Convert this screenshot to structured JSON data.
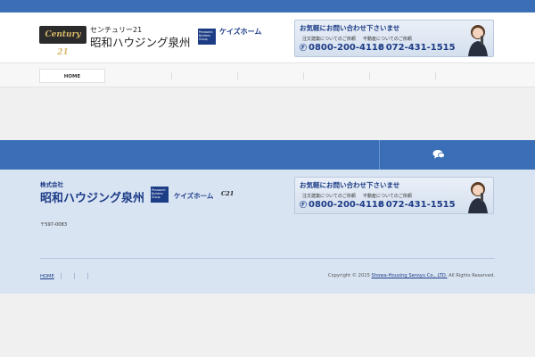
{
  "topbar": {
    "text": "",
    "links": [
      "",
      ""
    ]
  },
  "header": {
    "kana": "センチュリー21",
    "company": "昭和ハウジング泉州",
    "c21_logo": "Century 21",
    "panasonic": "Panasonic Builders Group",
    "keizu": "ケイズホーム",
    "tagline": ""
  },
  "contact": {
    "title": "お気軽にお問い合わせ下さいませ",
    "sub1": "注文建築についてのご依頼",
    "sub2": "不動産についてのご依頼",
    "num1": "0800-200-4118",
    "num2": "072-431-1515"
  },
  "nav": [
    {
      "label": "HOME",
      "active": true
    },
    {
      "label": ""
    },
    {
      "label": ""
    },
    {
      "label": ""
    },
    {
      "label": ""
    },
    {
      "label": ""
    },
    {
      "label": ""
    }
  ],
  "main": {
    "notice": ""
  },
  "banner": {
    "text": "",
    "chat_text": ""
  },
  "footer": {
    "company_small": "株式会社",
    "company_big": "昭和ハウジング泉州",
    "keizu": "ケイズホーム",
    "c21": "C21",
    "panasonic": "Panasonic Builders Group",
    "address1": "〒597-0083",
    "address2": "",
    "address3": "",
    "links": [
      "HOME",
      "",
      "",
      ""
    ],
    "copyright_prefix": "Copyright © 2015",
    "copyright_company": "Showa-Housing Sensyu Co., LTD.",
    "copyright_suffix": "All Rights Reserved."
  },
  "colors": {
    "primary": "#3a6fb7",
    "dark_blue": "#1c3c86",
    "footer_bg": "#d9e4f3"
  }
}
